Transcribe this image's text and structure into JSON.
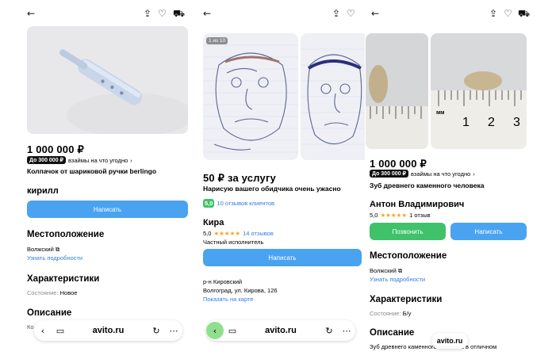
{
  "colors": {
    "accent": "#4aa3f0",
    "call": "#3fc26a",
    "link": "#2f7de1",
    "star": "#f7a51c"
  },
  "icons": {
    "back": "arrow-left-icon",
    "share": "share-icon",
    "fav": "heart-icon",
    "cart": "cart-icon",
    "more": "more-icon",
    "reload": "reload-icon",
    "tabs": "tabs-icon"
  },
  "panel1": {
    "price": "1 000 000 ₽",
    "badge": "До 300 000 ₽",
    "exchange": "взаймы на что угодно",
    "title": "Колпачок от шариковой ручки berlingo",
    "seller": "кирилл",
    "write_button": "Написать",
    "location_heading": "Местоположение",
    "city": "Волжский",
    "details_link": "Узнать подробности",
    "specs_heading": "Характеристики",
    "condition_label": "Состояние:",
    "condition_value": "Новое",
    "description_heading": "Описание",
    "desc_fade": "Ко",
    "browser_url": "avito.ru"
  },
  "panel2": {
    "counter": "1 из 10",
    "price": "50 ₽ за услугу",
    "title": "Нарисую вашего обидчика очень ужасно",
    "rating_badge": "5,0",
    "reviews_clients": "10 отзывов клиентов",
    "seller": "Кира",
    "rating": "5,0",
    "stars": "★★★★★",
    "reviews": "14 отзывов",
    "seller_type": "Частный исполнитель",
    "write_button": "Написать",
    "district": "р-н Кировский",
    "address": "Волгоград, ул. Кирова, 126",
    "map_link": "Показать на карте",
    "browser_url": "avito.ru"
  },
  "panel3": {
    "price": "1 000 000 ₽",
    "badge": "До 300 000 ₽",
    "exchange": "взаймы на что угодно",
    "title": "Зуб древнего каменного человека",
    "seller": "Антон Владимирович",
    "rating": "5,0",
    "stars": "★★★★★",
    "reviews": "1 отзыв",
    "call_button": "Позвонить",
    "write_button": "Написать",
    "location_heading": "Местоположение",
    "city": "Волжский",
    "details_link": "Узнать подробности",
    "specs_heading": "Характеристики",
    "condition_label": "Состояние:",
    "condition_value": "Б/у",
    "description_heading": "Описание",
    "description_text": "Зуб древнего каменного человека в отличном",
    "browser_url": "avito.ru",
    "ruler_labels": [
      "мм",
      "1",
      "2",
      "3"
    ]
  }
}
